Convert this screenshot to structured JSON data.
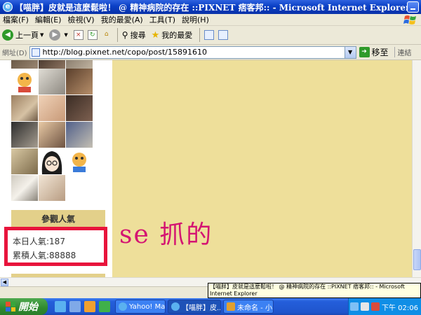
{
  "window": {
    "title": "【喵胖】皮就是這麼鬆啦！ @ 精神病院的存在 ::PIXNET 痞客邦:: - Microsoft Internet Explorer",
    "ie_glyph": "e"
  },
  "menu": {
    "items": [
      "檔案(F)",
      "編輯(E)",
      "檢視(V)",
      "我的最愛(A)",
      "工具(T)",
      "說明(H)"
    ]
  },
  "toolbar": {
    "back_label": "上一頁",
    "back_glyph": "◀",
    "forward_glyph": "▶",
    "search_label": "搜尋",
    "favorites_label": "我的最愛",
    "drop_glyph": "▼"
  },
  "address": {
    "label": "網址(D)",
    "url": "http://blog.pixnet.net/copo/post/15891610",
    "go_label": "移至",
    "go_glyph": "➜",
    "links_label": "連結",
    "drop_glyph": "▼"
  },
  "sidebar": {
    "hits_header": "參觀人氣",
    "hits_today": "本日人氣:187",
    "hits_total": "累積人氣:88888"
  },
  "annotation": {
    "text": "se 抓的",
    "color": "#d41472"
  },
  "scrollbar": {
    "left_arrow_glyph": "◀"
  },
  "tooltip": {
    "text": "【喵胖】皮就是這麼鬆啦！ @ 精神病院的存在 ::PIXNET 痞客邦:: - Microsoft Internet Explorer"
  },
  "taskbar": {
    "start_label": "開始",
    "tasks": [
      {
        "label": "Yahoo! Mail ...",
        "active": false
      },
      {
        "label": "【喵胖】皮...",
        "active": true
      },
      {
        "label": "未命名 - 小...",
        "active": false
      }
    ],
    "clock": "下午 02:06"
  },
  "colors": {
    "page_background": "#eedf9a",
    "highlight_box": "#e8143c",
    "sidebar_header": "#e3d08a"
  }
}
